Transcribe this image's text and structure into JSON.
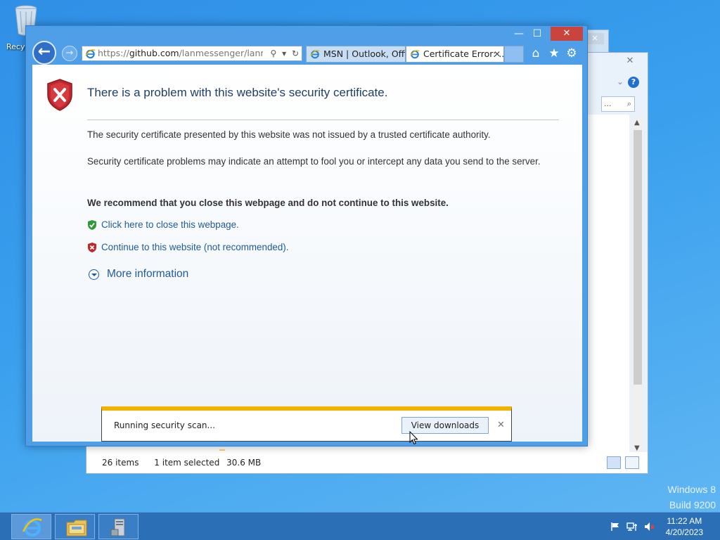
{
  "desktop": {
    "recycle_bin_label": "Recycle Bin",
    "watermark_line1": "Windows 8",
    "watermark_line2": "Build 9200"
  },
  "explorer": {
    "close_glyph": "✕",
    "search_placeholder": "...",
    "status_items": "26 items",
    "status_selected": "1 item selected",
    "status_size": "30.6 MB"
  },
  "browser": {
    "caption": {
      "minimize": "—",
      "maximize": "☐",
      "close": "✕"
    },
    "address": {
      "prefix": "https://",
      "domain": "github.com",
      "path": "/lanmessenger/lanmesse"
    },
    "tabs": [
      {
        "label": "MSN | Outlook, Offi..."
      },
      {
        "label": "Certificate Error: ...",
        "close": "✕"
      }
    ]
  },
  "page": {
    "title": "There is a problem with this website's security certificate.",
    "message1": "The security certificate presented by this website was not issued by a trusted certificate authority.",
    "message2": "Security certificate problems may indicate an attempt to fool you or intercept any data you send to the server.",
    "recommendation": "We recommend that you close this webpage and do not continue to this website.",
    "link_close": "Click here to close this webpage.",
    "link_continue": "Continue to this website (not recommended).",
    "more_info": "More information"
  },
  "download_bar": {
    "status": "Running security scan...",
    "button": "View downloads",
    "close": "✕"
  },
  "taskbar": {
    "time": "11:22 AM",
    "date": "4/20/2023"
  },
  "colors": {
    "accent": "#2f7fd0",
    "error_shield": "#c0272d",
    "ok_shield": "#2e9a3a",
    "link": "#1f5b99",
    "notify_bar": "#f0b400",
    "close_button": "#c9443c"
  }
}
